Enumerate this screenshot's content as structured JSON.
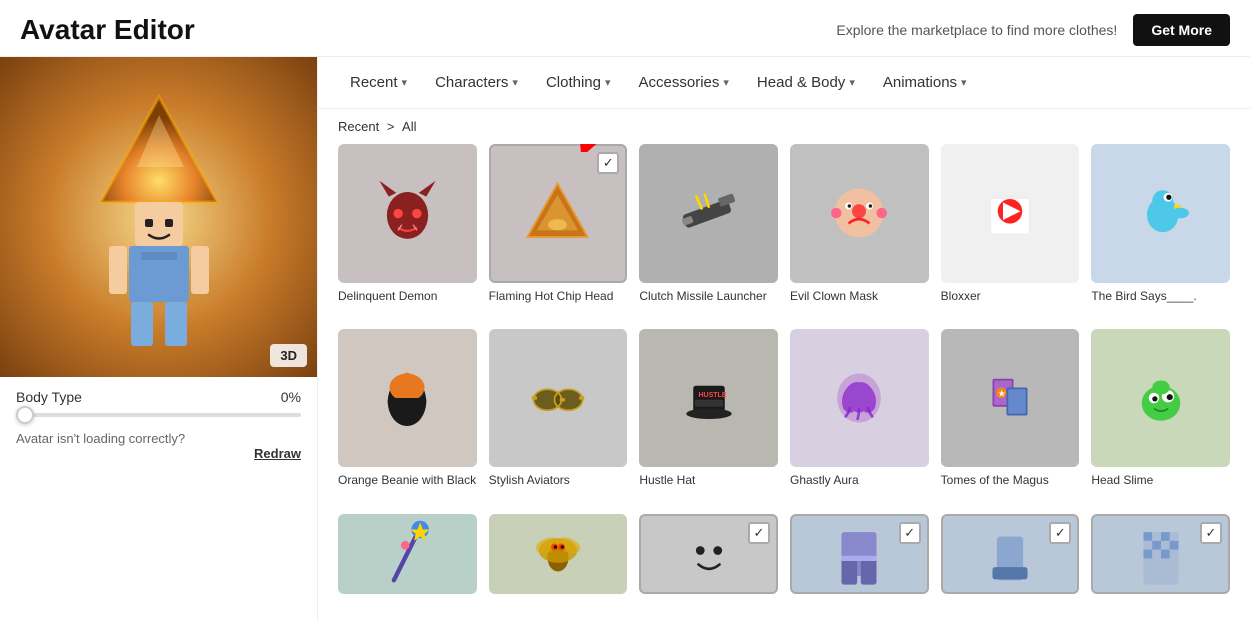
{
  "header": {
    "title": "Avatar Editor",
    "marketplace_text": "Explore the marketplace to find more clothes!",
    "get_more_label": "Get More"
  },
  "nav": {
    "tabs": [
      {
        "label": "Recent",
        "id": "recent"
      },
      {
        "label": "Characters",
        "id": "characters"
      },
      {
        "label": "Clothing",
        "id": "clothing"
      },
      {
        "label": "Accessories",
        "id": "accessories"
      },
      {
        "label": "Head & Body",
        "id": "head-body"
      },
      {
        "label": "Animations",
        "id": "animations"
      }
    ]
  },
  "breadcrumb": {
    "parent": "Recent",
    "current": "All"
  },
  "avatar": {
    "body_type_label": "Body Type",
    "body_type_pct": "0%",
    "badge_3d": "3D",
    "error_text": "Avatar isn't loading correctly?",
    "redraw_label": "Redraw"
  },
  "items": [
    {
      "id": "delinquent-demon",
      "name": "Delinquent Demon",
      "thumb_class": "thumb-demon",
      "emoji": "👹",
      "selected": false
    },
    {
      "id": "flaming-chip",
      "name": "Flaming Hot Chip Head",
      "thumb_class": "thumb-chip",
      "emoji": "🔺",
      "selected": true
    },
    {
      "id": "clutch-missile",
      "name": "Clutch Missile Launcher",
      "thumb_class": "thumb-missile",
      "emoji": "🔫",
      "selected": false
    },
    {
      "id": "evil-clown",
      "name": "Evil Clown Mask",
      "thumb_class": "thumb-clown",
      "emoji": "🤡",
      "selected": false
    },
    {
      "id": "bloxxer",
      "name": "Bloxxer",
      "thumb_class": "thumb-bloxxer",
      "emoji": "👕",
      "selected": false
    },
    {
      "id": "bird-says",
      "name": "The Bird Says____.",
      "thumb_class": "thumb-bird",
      "emoji": "🐦",
      "selected": false
    },
    {
      "id": "orange-beanie",
      "name": "Orange Beanie with Black",
      "thumb_class": "thumb-beanie",
      "emoji": "🧢",
      "selected": false
    },
    {
      "id": "stylish-aviators",
      "name": "Stylish Aviators",
      "thumb_class": "thumb-aviators",
      "emoji": "🕶️",
      "selected": false
    },
    {
      "id": "hustle-hat",
      "name": "Hustle Hat",
      "thumb_class": "thumb-hustle",
      "emoji": "🎩",
      "selected": false
    },
    {
      "id": "ghastly-aura",
      "name": "Ghastly Aura",
      "thumb_class": "thumb-ghastly",
      "emoji": "💜",
      "selected": false
    },
    {
      "id": "tomes-magus",
      "name": "Tomes of the Magus",
      "thumb_class": "thumb-tomes",
      "emoji": "📚",
      "selected": false
    },
    {
      "id": "head-slime",
      "name": "Head Slime",
      "thumb_class": "thumb-headslime",
      "emoji": "🟢",
      "selected": false
    },
    {
      "id": "staff-item",
      "name": "",
      "thumb_class": "thumb-staff",
      "emoji": "🪄",
      "selected": false
    },
    {
      "id": "fly-item",
      "name": "",
      "thumb_class": "thumb-fly",
      "emoji": "🪰",
      "selected": false
    },
    {
      "id": "smiley-item",
      "name": "",
      "thumb_class": "thumb-smiley",
      "emoji": "😊",
      "selected": true
    },
    {
      "id": "blue1-item",
      "name": "",
      "thumb_class": "thumb-blue1",
      "emoji": "🟦",
      "selected": true
    },
    {
      "id": "blue2-item",
      "name": "",
      "thumb_class": "thumb-blue2",
      "emoji": "🟦",
      "selected": true
    },
    {
      "id": "blue3-item",
      "name": "",
      "thumb_class": "thumb-blue3",
      "emoji": "🟦",
      "selected": true
    }
  ]
}
